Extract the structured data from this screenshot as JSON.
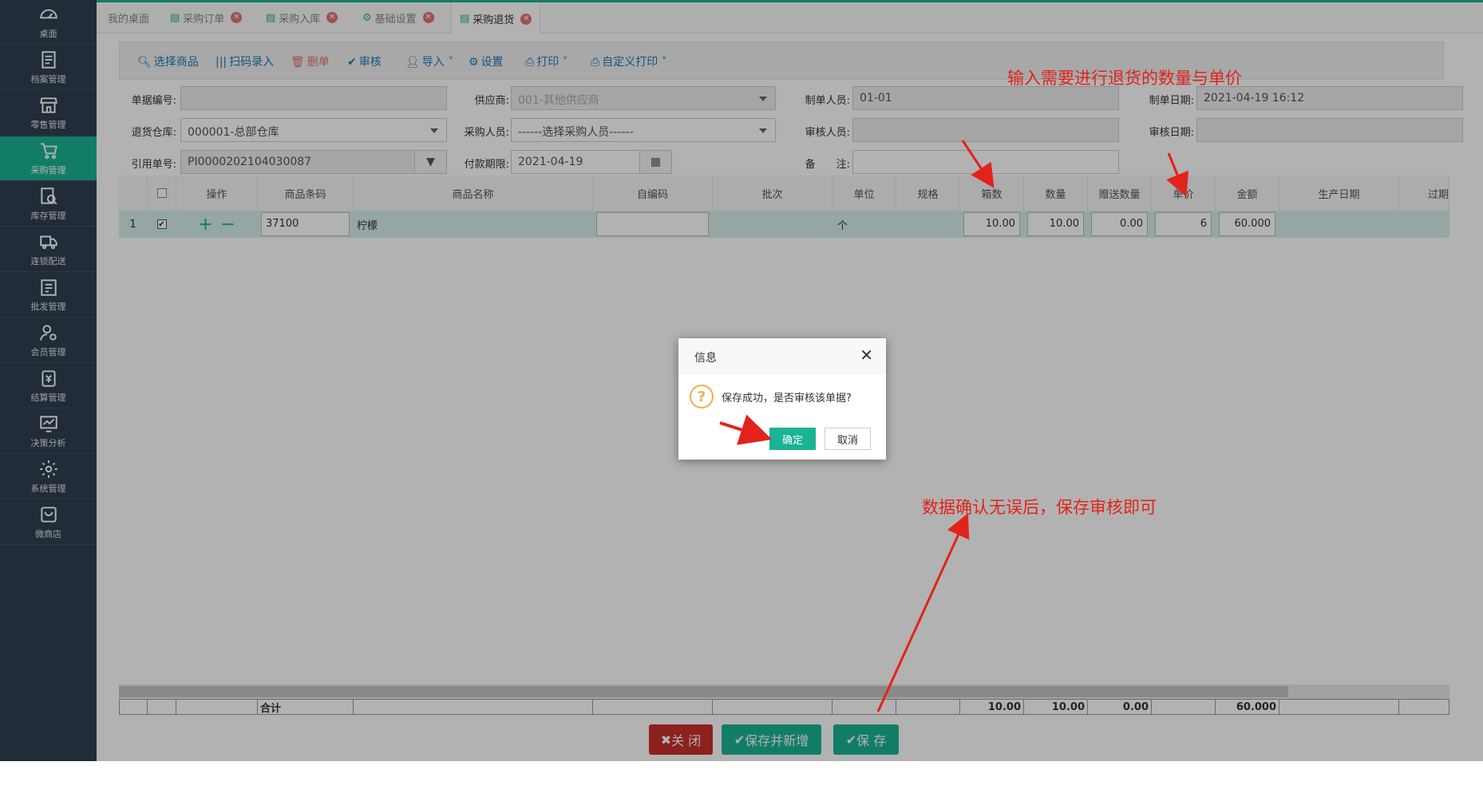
{
  "sidebar": {
    "items": [
      {
        "label": "桌面",
        "icon": "dashboard-icon"
      },
      {
        "label": "档案管理",
        "icon": "file-icon"
      },
      {
        "label": "零售管理",
        "icon": "store-icon"
      },
      {
        "label": "采购管理",
        "icon": "purchase-icon"
      },
      {
        "label": "库存管理",
        "icon": "inventory-icon"
      },
      {
        "label": "连锁配送",
        "icon": "delivery-icon"
      },
      {
        "label": "批发管理",
        "icon": "wholesale-icon"
      },
      {
        "label": "会员管理",
        "icon": "member-icon"
      },
      {
        "label": "结算管理",
        "icon": "settlement-icon"
      },
      {
        "label": "决策分析",
        "icon": "analysis-icon"
      },
      {
        "label": "系统管理",
        "icon": "gear-icon"
      },
      {
        "label": "微商店",
        "icon": "shop-bag-icon"
      }
    ],
    "active_color": "#1ab394"
  },
  "tabs": [
    {
      "label": "我的桌面"
    },
    {
      "label": "采购订单"
    },
    {
      "label": "采购入库"
    },
    {
      "label": "基础设置"
    },
    {
      "label": "采购退货"
    }
  ],
  "toolbar": {
    "select_goods": "选择商品",
    "scan_entry": "扫码录入",
    "delete": "删单",
    "audit": "审核",
    "import": "导入",
    "settings": "设置",
    "print": "打印",
    "custom_print": "自定义打印"
  },
  "form": {
    "doc_no_label": "单据编号:",
    "doc_no_value": "",
    "supplier_label": "供应商:",
    "supplier_value": "001-其他供应商",
    "maker_label": "制单人员:",
    "maker_value": "01-01",
    "make_date_label": "制单日期:",
    "make_date_value": "2021-04-19 16:12",
    "warehouse_label": "退货仓库:",
    "warehouse_value": "000001-总部仓库",
    "buyer_label": "采购人员:",
    "buyer_value": "------选择采购人员------",
    "auditor_label": "审核人员:",
    "auditor_value": "",
    "audit_date_label": "审核日期:",
    "audit_date_value": "",
    "ref_no_label": "引用单号:",
    "ref_no_value": "PI0000202104030087",
    "pay_term_label": "付款期限:",
    "pay_term_value": "2021-04-19",
    "remark_label": "备　　注:",
    "remark_value": ""
  },
  "grid": {
    "headers": {
      "op": "操作",
      "barcode": "商品条码",
      "name": "商品名称",
      "selfcode": "自编码",
      "batch": "批次",
      "unit": "单位",
      "spec": "规格",
      "boxes": "箱数",
      "qty": "数量",
      "gift": "赠送数量",
      "price": "单价",
      "amount": "金额",
      "prod_date": "生产日期",
      "expire": "过期"
    },
    "row": {
      "index": "1",
      "barcode": "37100",
      "name": "柠檬",
      "selfcode": "",
      "unit": "个",
      "boxes": "10.00",
      "qty": "10.00",
      "gift": "0.00",
      "price": "6",
      "amount": "60.000"
    },
    "footer": {
      "label": "合计",
      "boxes": "10.00",
      "qty": "10.00",
      "gift": "0.00",
      "amount": "60.000"
    }
  },
  "bottom_buttons": {
    "close": "关 闭",
    "save_new": "保存并新增",
    "save": "保 存"
  },
  "dialog": {
    "title": "信息",
    "message": "保存成功，是否审核该单据?",
    "confirm": "确定",
    "cancel": "取消"
  },
  "annotations": {
    "top": "输入需要进行退货的数量与单价",
    "bottom": "数据确认无误后，保存审核即可"
  }
}
